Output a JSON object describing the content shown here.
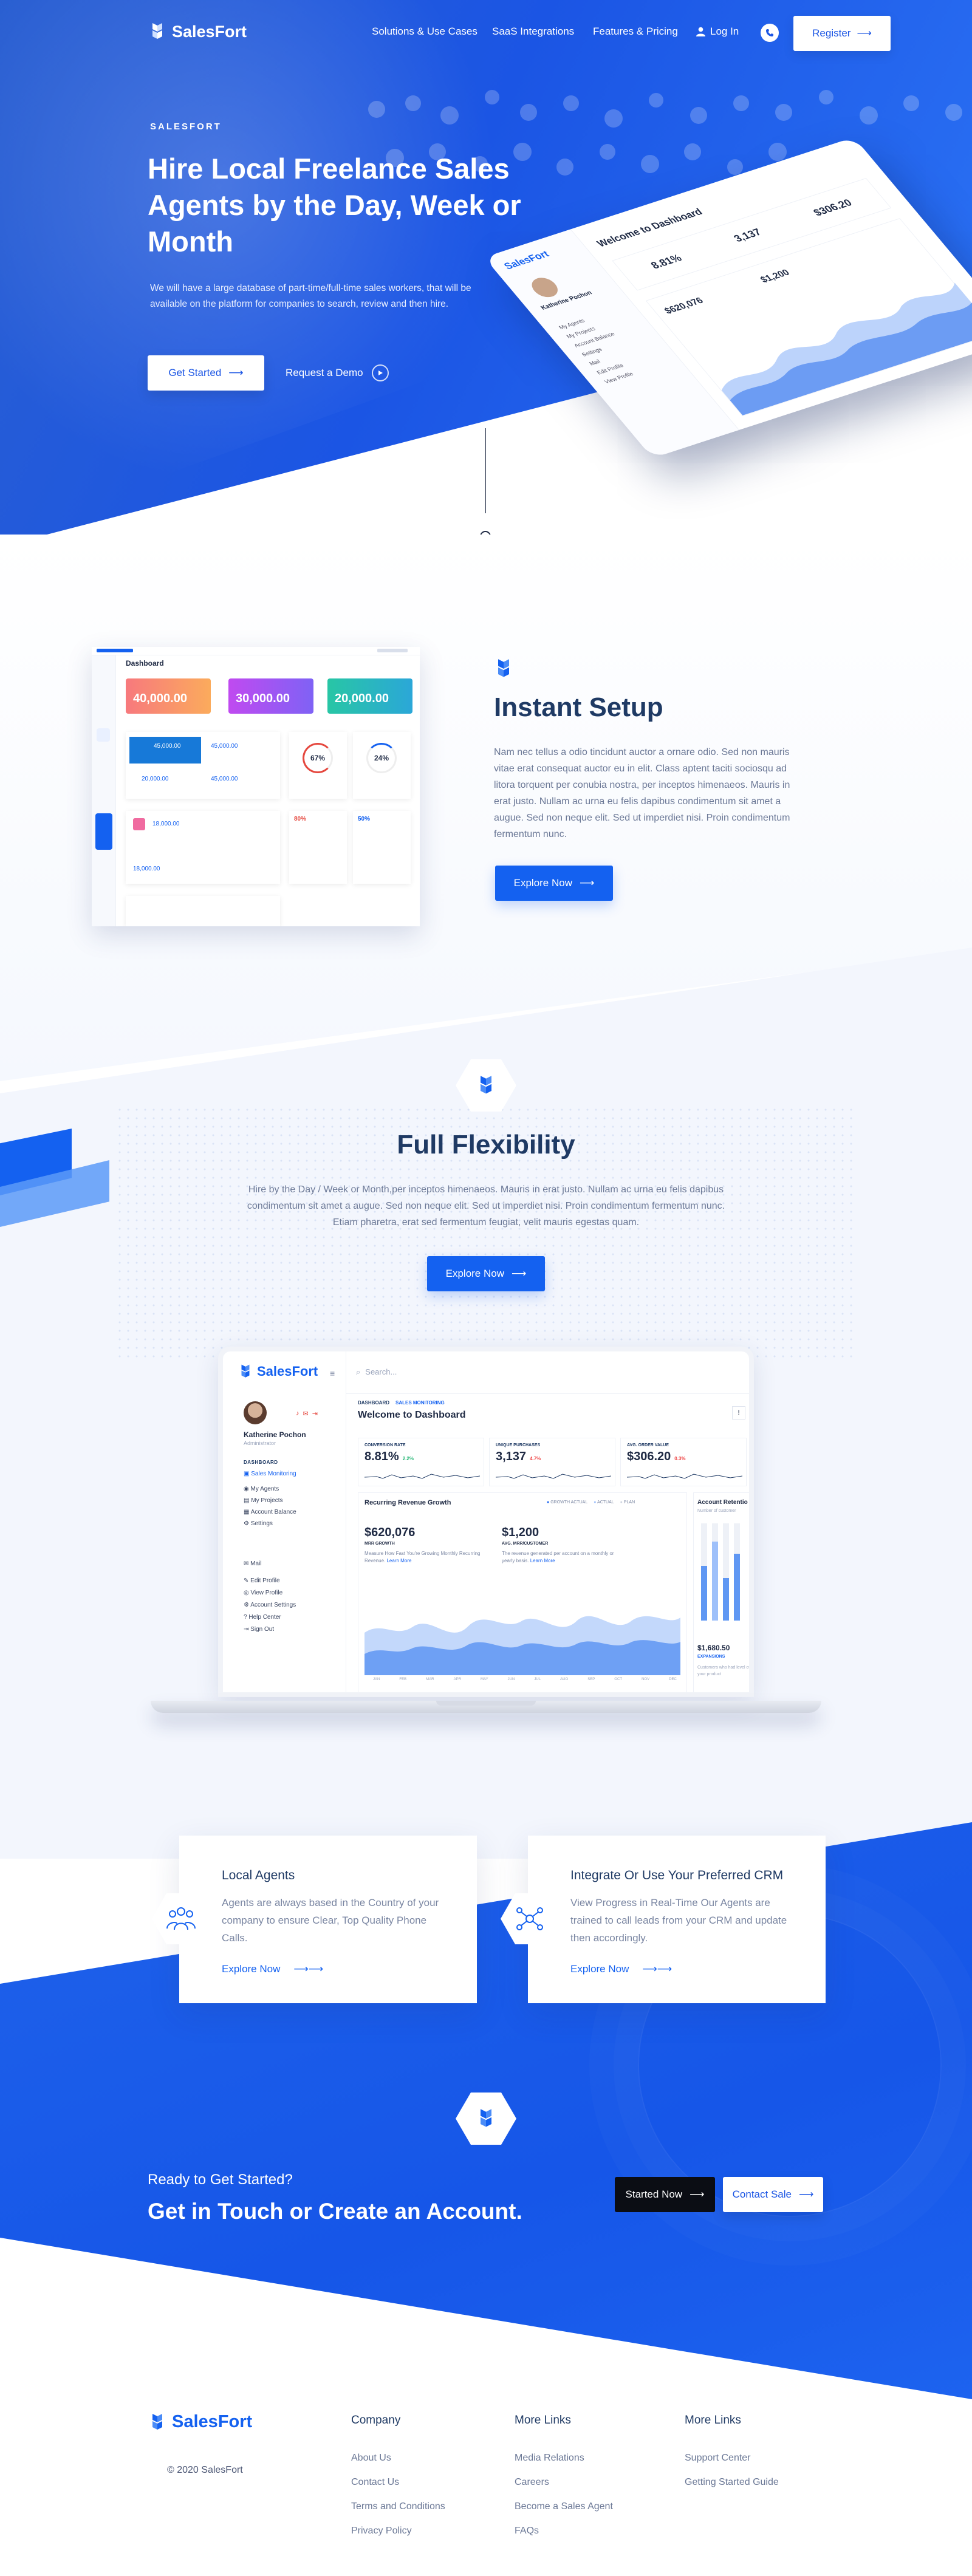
{
  "nav": {
    "brand": "SalesFort",
    "links": [
      "Solutions & Use Cases",
      "SaaS Integrations",
      "Features & Pricing"
    ],
    "login": "Log In",
    "register": "Register"
  },
  "hero": {
    "eyebrow": "SALESFORT",
    "title": "Hire Local Freelance Sales Agents by the Day, Week or Month",
    "description": "We will have a large database of part-time/full-time sales workers, that will be available on the platform for companies to search, review and then hire.",
    "cta_primary": "Get Started",
    "cta_secondary": "Request a Demo"
  },
  "hero_dashboard": {
    "welcome": "Welcome to Dashboard",
    "user": "Katherine Pochon",
    "values": [
      "8.81%",
      "3,137",
      "$306.20",
      "$620,076",
      "$1,200"
    ],
    "menu": [
      "My Agents",
      "My Projects",
      "Account Balance",
      "Settings",
      "Mail",
      "Edit Profile",
      "View Profile"
    ]
  },
  "setup": {
    "title": "Instant Setup",
    "text": "Nam nec tellus a odio tincidunt auctor a ornare odio. Sed non mauris vitae erat consequat auctor eu in elit. Class aptent taciti sociosqu ad litora torquent per conubia nostra, per inceptos himenaeos. Mauris in erat justo. Nullam ac urna eu felis dapibus condimentum sit amet a augue. Sed non neque elit. Sed ut imperdiet nisi. Proin condimentum fermentum nunc.",
    "button": "Explore Now",
    "shot": {
      "title": "Dashboard",
      "tiles": [
        "40,000.00",
        "30,000.00",
        "20,000.00"
      ],
      "small_values": [
        "45,000.00",
        "45,000.00",
        "20,000.00",
        "45,000.00",
        "18,000.00",
        "18,000.00"
      ],
      "gauges": [
        "67%",
        "24%"
      ],
      "percents": [
        "80%",
        "50%"
      ]
    }
  },
  "flex": {
    "title": "Full Flexibility",
    "text": "Hire by the Day / Week or Month,per inceptos himenaeos. Mauris in erat justo. Nullam ac urna eu felis dapibus condimentum sit amet a augue. Sed non neque elit. Sed ut imperdiet nisi. Proin condimentum fermentum nunc. Etiam pharetra, erat sed fermentum feugiat, velit mauris egestas quam.",
    "button": "Explore Now"
  },
  "laptop": {
    "brand": "SalesFort",
    "search": "Search...",
    "breadcrumb": [
      "DASHBOARD",
      "SALES MONITORING"
    ],
    "welcome": "Welcome to Dashboard",
    "user_name": "Katherine Pochon",
    "user_role": "Administrator",
    "menu_heading": "DASHBOARD",
    "menu": [
      "Sales Monitoring",
      "My Agents",
      "My Projects",
      "Account Balance",
      "Settings"
    ],
    "menu2": [
      "Mail",
      "Edit Profile",
      "View Profile",
      "Account Settings",
      "Help Center",
      "Sign Out"
    ],
    "kpis": [
      {
        "label": "CONVERSION RATE",
        "value": "8.81%",
        "delta": "2.2%",
        "color": "#22b573"
      },
      {
        "label": "UNIQUE PURCHASES",
        "value": "3,137",
        "delta": "4.7%",
        "color": "#ef4444"
      },
      {
        "label": "AVG. ORDER VALUE",
        "value": "$306.20",
        "delta": "0.3%",
        "color": "#ef4444"
      }
    ],
    "growth": {
      "title": "Recurring Revenue Growth",
      "legend": [
        "GROWTH ACTUAL",
        "ACTUAL",
        "PLAN"
      ],
      "mrr_value": "$620,076",
      "mrr_label": "MRR GROWTH",
      "mrr_text": "Measure How Fast You're Growing Monthly Recurring Revenue.",
      "arr_value": "$1,200",
      "arr_label": "AVG. MRR/CUSTOMER",
      "arr_text": "The revenue generated per account on a monthly or yearly basis.",
      "learn_more": "Learn More",
      "months": [
        "JAN",
        "FEB",
        "MAR",
        "APR",
        "MAY",
        "JUN",
        "JUL",
        "AUG",
        "SEP",
        "OCT",
        "NOV",
        "DEC"
      ]
    },
    "retention": {
      "title": "Account Retentio",
      "sub": "Number of customer",
      "value": "$1,680.50",
      "label": "EXPANSIONS",
      "text": "Customers who had level of your product"
    }
  },
  "cards": [
    {
      "title": "Local Agents",
      "text": "Agents are always based in the Country of your company to ensure Clear, Top Quality Phone Calls.",
      "link": "Explore Now"
    },
    {
      "title": "Integrate Or Use Your Preferred CRM",
      "text": "View Progress in Real-Time Our Agents are trained to call leads from your CRM and update then accordingly.",
      "link": "Explore Now"
    }
  ],
  "cta": {
    "question": "Ready to Get Started?",
    "headline": "Get in Touch or Create an Account.",
    "start": "Started Now",
    "contact": "Contact Sale"
  },
  "footer": {
    "brand": "SalesFort",
    "copyright": "© 2020 SalesFort",
    "columns": [
      {
        "title": "Company",
        "links": [
          "About Us",
          "Contact Us",
          "Terms and Conditions",
          "Privacy Policy"
        ]
      },
      {
        "title": "More Links",
        "links": [
          "Media Relations",
          "Careers",
          "Become a Sales Agent",
          "FAQs"
        ]
      },
      {
        "title": "More Links",
        "links": [
          "Support Center",
          "Getting Started Guide"
        ]
      }
    ]
  },
  "colors": {
    "primary": "#1461f0",
    "dark": "#1f3a64",
    "text": "#6b7896",
    "black_button": "#0b0d14"
  }
}
